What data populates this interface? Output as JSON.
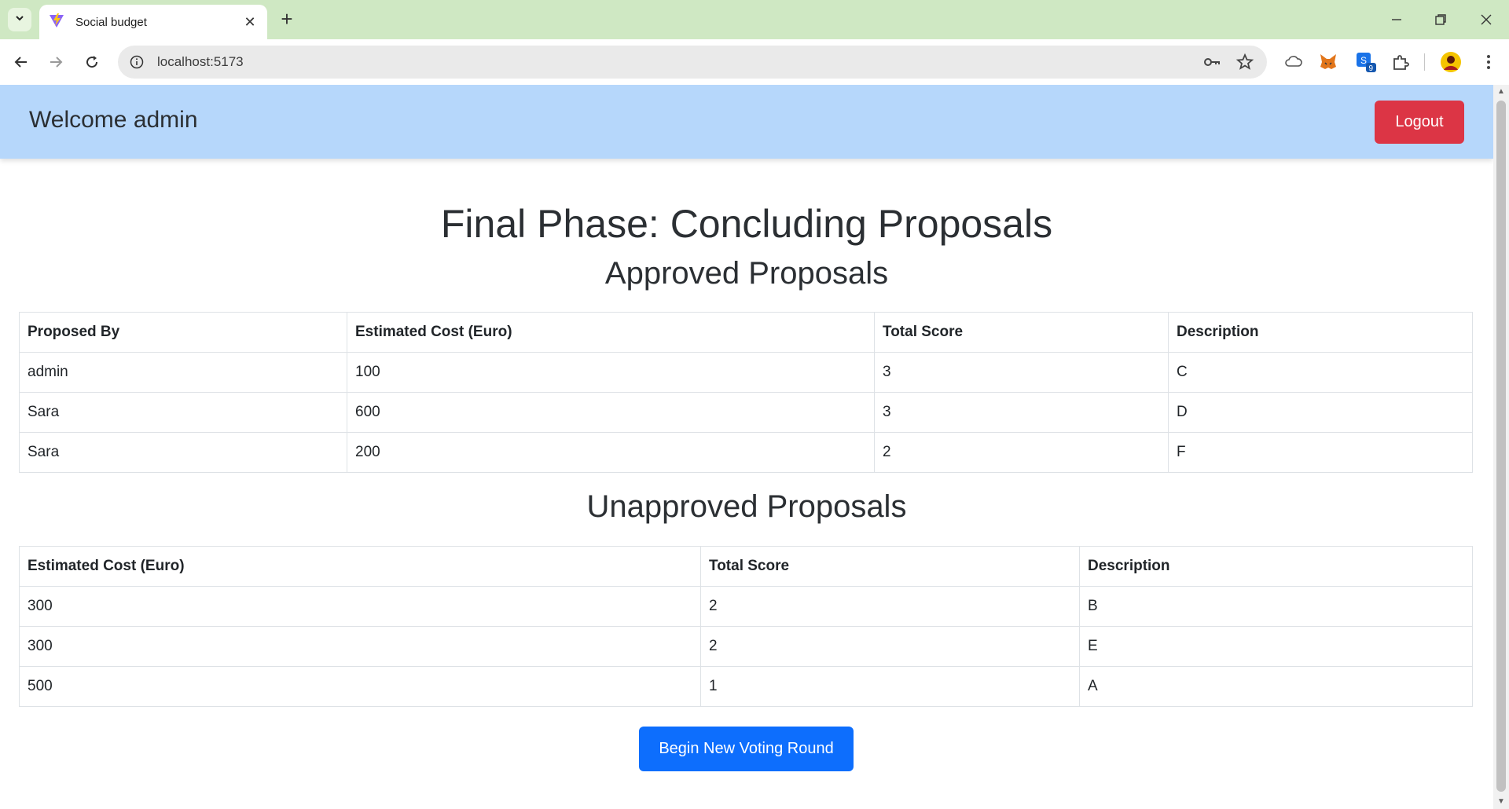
{
  "browser": {
    "tab_title": "Social budget",
    "url": "localhost:5173",
    "extension_badge": "9"
  },
  "header": {
    "welcome": "Welcome admin",
    "logout_label": "Logout"
  },
  "main": {
    "title": "Final Phase: Concluding Proposals",
    "approved": {
      "heading": "Approved Proposals",
      "columns": [
        "Proposed By",
        "Estimated Cost (Euro)",
        "Total Score",
        "Description"
      ],
      "rows": [
        [
          "admin",
          "100",
          "3",
          "C"
        ],
        [
          "Sara",
          "600",
          "3",
          "D"
        ],
        [
          "Sara",
          "200",
          "2",
          "F"
        ]
      ]
    },
    "unapproved": {
      "heading": "Unapproved Proposals",
      "columns": [
        "Estimated Cost (Euro)",
        "Total Score",
        "Description"
      ],
      "rows": [
        [
          "300",
          "2",
          "B"
        ],
        [
          "300",
          "2",
          "E"
        ],
        [
          "500",
          "1",
          "A"
        ]
      ]
    },
    "begin_label": "Begin New Voting Round"
  },
  "colors": {
    "header_bg": "#b6d7fb",
    "logout": "#dc3545",
    "primary": "#0d6efd",
    "tabbar": "#cfe8c3"
  }
}
